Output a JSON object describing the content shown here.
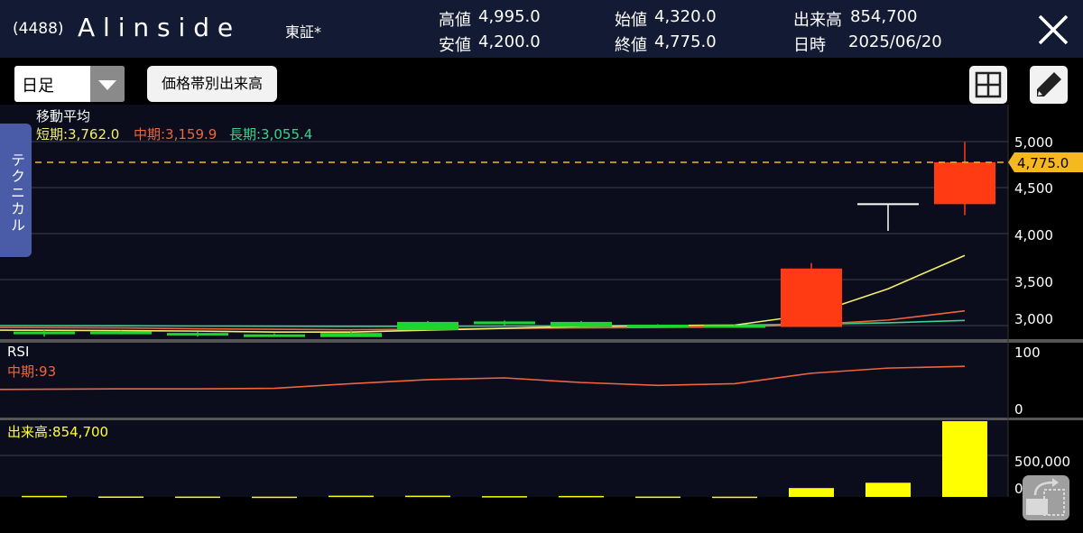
{
  "header": {
    "code": "(4488)",
    "name": "A l i n s i d e",
    "market": "東証*",
    "high_label": "高値",
    "high_value": "4,995.0",
    "low_label": "安値",
    "low_value": "4,200.0",
    "open_label": "始値",
    "open_value": "4,320.0",
    "close_label": "終値",
    "close_value": "4,775.0",
    "volume_label": "出来高",
    "volume_value": "854,700",
    "date_label": "日時",
    "date_value": "2025/06/20"
  },
  "toolbar": {
    "period_select_value": "日足",
    "volume_profile_label": "価格帯別出来高"
  },
  "side_tab": {
    "label": "テクニカル"
  },
  "price_panel": {
    "title": "移動平均",
    "short_label": "短期:3,762.0",
    "mid_label": "中期:3,159.9",
    "long_label": "長期:3,055.4",
    "current_price_label": "4,775.0",
    "y_ticks": [
      "5,000",
      "4,500",
      "4,000",
      "3,500",
      "3,000"
    ]
  },
  "rsi_panel": {
    "title": "RSI",
    "mid_label": "中期:93",
    "y_ticks": [
      "100",
      "0"
    ]
  },
  "volume_panel": {
    "title": "出来高:854,700",
    "y_ticks": [
      "500,000",
      "0"
    ]
  },
  "colors": {
    "header_bg": "#131a33",
    "up_candle": "#ff3b14",
    "down_candle": "#1ed42e",
    "short_ma": "#f3ee6c",
    "mid_ma": "#f0643c",
    "long_ma": "#38d48c",
    "rsi_line": "#f0643c",
    "volume_bar": "#ffff00",
    "current_price_tag": "#f5b820"
  },
  "chart_data": {
    "type": "candlestick",
    "candles": [
      {
        "o": 2935,
        "h": 2950,
        "l": 2880,
        "c": 2930
      },
      {
        "o": 2935,
        "h": 2945,
        "l": 2905,
        "c": 2930
      },
      {
        "o": 2920,
        "h": 2930,
        "l": 2880,
        "c": 2915
      },
      {
        "o": 2905,
        "h": 2915,
        "l": 2890,
        "c": 2895
      },
      {
        "o": 2920,
        "h": 2945,
        "l": 2880,
        "c": 2875
      },
      {
        "o": 3040,
        "h": 3050,
        "l": 2950,
        "c": 2950
      },
      {
        "o": 3045,
        "h": 3055,
        "l": 2995,
        "c": 3015
      },
      {
        "o": 3040,
        "h": 3050,
        "l": 2980,
        "c": 2985
      },
      {
        "o": 3010,
        "h": 3015,
        "l": 2985,
        "c": 3000
      },
      {
        "o": 3005,
        "h": 3010,
        "l": 2980,
        "c": 2985
      },
      {
        "o": 2985,
        "h": 3680,
        "l": 2985,
        "c": 3620
      },
      {
        "o": 4320,
        "h": 4320,
        "l": 4030,
        "c": 4320
      },
      {
        "o": 4320,
        "h": 4995,
        "l": 4200,
        "c": 4775
      }
    ],
    "ma_short": [
      2950,
      2945,
      2940,
      2930,
      2930,
      2950,
      2970,
      2990,
      3000,
      3005,
      3120,
      3400,
      3762
    ],
    "ma_mid": [
      2980,
      2975,
      2965,
      2960,
      2955,
      2960,
      2970,
      2975,
      2980,
      2985,
      3010,
      3060,
      3159.9
    ],
    "ma_long": [
      3000,
      2998,
      2995,
      2993,
      2992,
      2992,
      2995,
      2997,
      3000,
      3005,
      3015,
      3030,
      3055.4
    ],
    "rsi": [
      30,
      31,
      31,
      32,
      40,
      47,
      50,
      42,
      37,
      40,
      58,
      67,
      70
    ],
    "volume": [
      12000,
      5000,
      4000,
      3000,
      14000,
      14000,
      9000,
      11000,
      4000,
      3000,
      100000,
      160000,
      854700
    ],
    "price_ylim": [
      2850,
      5000
    ],
    "rsi_ylim": [
      0,
      100
    ],
    "volume_ylim": [
      0,
      854700
    ]
  }
}
